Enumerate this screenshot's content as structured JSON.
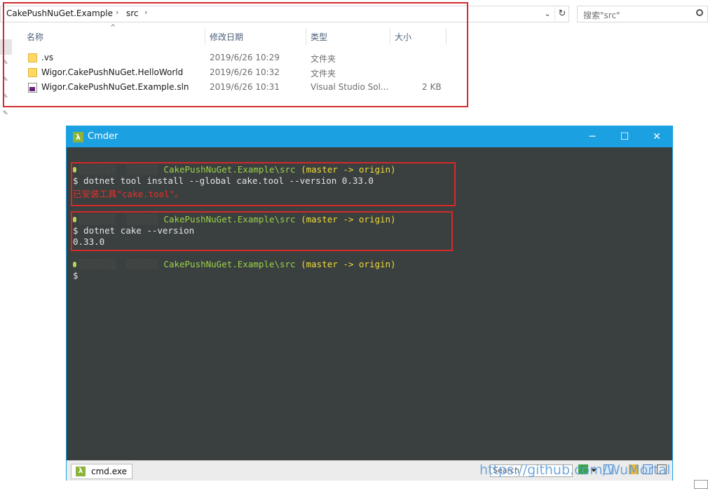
{
  "explorer": {
    "breadcrumb": [
      "CakePushNuGet.Example",
      "src"
    ],
    "search_placeholder": "搜索\"src\"",
    "columns": {
      "name": "名称",
      "modified": "修改日期",
      "type": "类型",
      "size": "大小"
    },
    "files": [
      {
        "name": ".vs",
        "modified": "2019/6/26 10:29",
        "type": "文件夹",
        "size": "",
        "icon": "folder-icon"
      },
      {
        "name": "Wigor.CakePushNuGet.HelloWorld",
        "modified": "2019/6/26 10:32",
        "type": "文件夹",
        "size": "",
        "icon": "folder-icon"
      },
      {
        "name": "Wigor.CakePushNuGet.Example.sln",
        "modified": "2019/6/26 10:31",
        "type": "Visual Studio Sol...",
        "size": "2 KB",
        "icon": "visual-studio-solution-icon"
      }
    ]
  },
  "cmder": {
    "title": "Cmder",
    "logo": "λ",
    "tab_label": "cmd.exe",
    "status_search": "Search",
    "prompts": [
      {
        "path": "CakePushNuGet.Example\\src",
        "branch": "(master -> origin)",
        "command": "$ dotnet tool install --global cake.tool --version 0.33.0",
        "output": "已安装工具\"cake.tool\"。",
        "output_color": "#e5322a"
      },
      {
        "path": "CakePushNuGet.Example\\src",
        "branch": "(master -> origin)",
        "command": "$ dotnet cake --version",
        "output": "0.33.0",
        "output_color": "#e6e6e6"
      },
      {
        "path": "CakePushNuGet.Example\\src",
        "branch": "(master -> origin)",
        "command": "$",
        "output": "",
        "output_color": "#e6e6e6"
      }
    ]
  },
  "watermark": "https://github.com/WuMortal",
  "colors": {
    "highlight_box": "#d42a2a",
    "cmder_accent": "#1ba1e2",
    "terminal_bg": "#3a3f3f",
    "path": "#9bd34a",
    "branch": "#f0dd3a"
  }
}
